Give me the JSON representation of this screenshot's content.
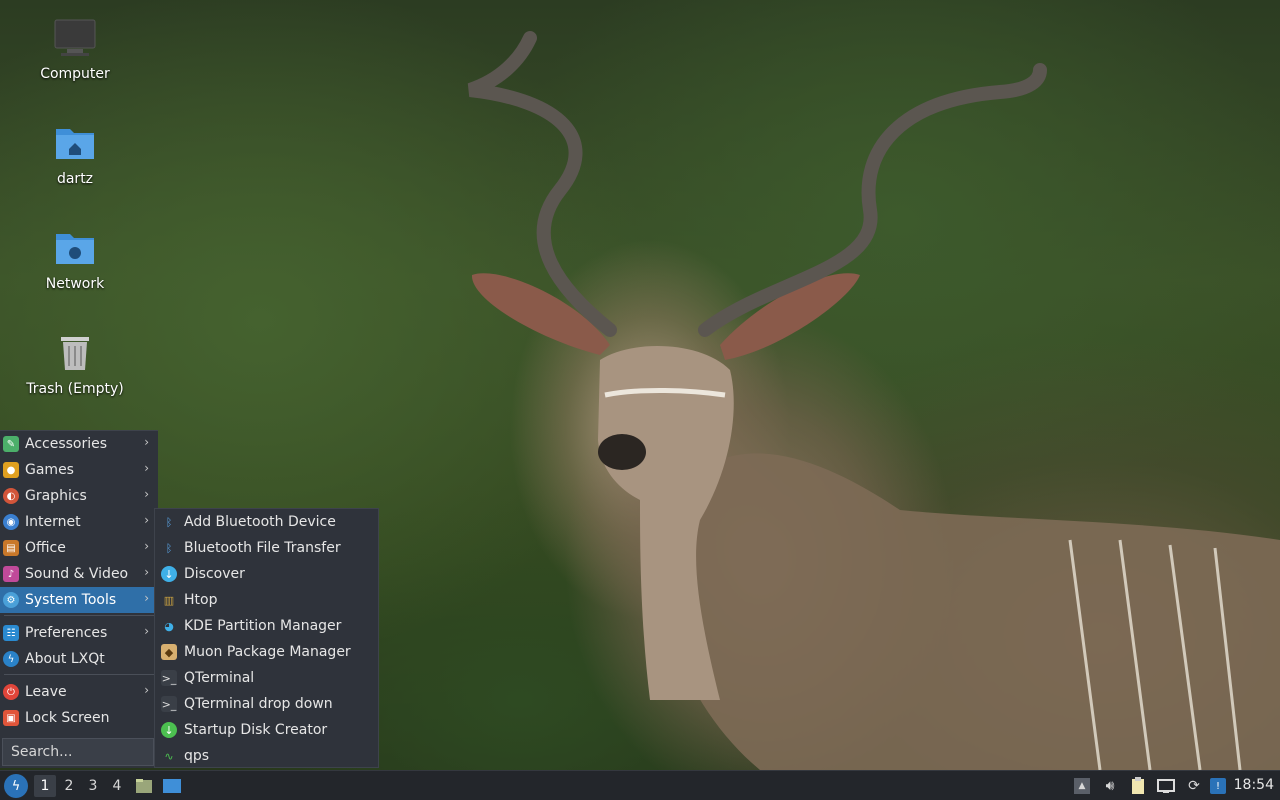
{
  "desktop": {
    "icons": [
      {
        "label": "Computer",
        "icon": "computer-icon"
      },
      {
        "label": "dartz",
        "icon": "home-folder-icon"
      },
      {
        "label": "Network",
        "icon": "network-folder-icon"
      },
      {
        "label": "Trash (Empty)",
        "icon": "trash-icon"
      }
    ]
  },
  "menu": {
    "items": [
      {
        "label": "Accessories",
        "icon": "accessories-icon",
        "color": "#4caf6a"
      },
      {
        "label": "Games",
        "icon": "games-icon",
        "color": "#e0a020"
      },
      {
        "label": "Graphics",
        "icon": "graphics-icon",
        "color": "#d2553a"
      },
      {
        "label": "Internet",
        "icon": "internet-icon",
        "color": "#3a7fd0"
      },
      {
        "label": "Office",
        "icon": "office-icon",
        "color": "#c8782a"
      },
      {
        "label": "Sound & Video",
        "icon": "sound-video-icon",
        "color": "#c04a9a"
      },
      {
        "label": "System Tools",
        "icon": "system-tools-icon",
        "color": "#4aa0d8"
      },
      {
        "label": "Preferences",
        "icon": "preferences-icon",
        "color": "#2a8ad0"
      },
      {
        "label": "About LXQt",
        "icon": "lxqt-icon",
        "color": "#2a82c8"
      },
      {
        "label": "Leave",
        "icon": "power-icon",
        "color": "#e0453a"
      },
      {
        "label": "Lock Screen",
        "icon": "lock-icon",
        "color": "#e0553a"
      }
    ],
    "search_placeholder": "Search..."
  },
  "submenu": {
    "items": [
      {
        "label": "Add Bluetooth Device",
        "icon": "bluetooth-icon"
      },
      {
        "label": "Bluetooth File Transfer",
        "icon": "bluetooth-icon"
      },
      {
        "label": "Discover",
        "icon": "discover-icon"
      },
      {
        "label": "Htop",
        "icon": "htop-icon"
      },
      {
        "label": "KDE Partition Manager",
        "icon": "partition-manager-icon"
      },
      {
        "label": "Muon Package Manager",
        "icon": "muon-icon"
      },
      {
        "label": "QTerminal",
        "icon": "terminal-icon"
      },
      {
        "label": "QTerminal drop down",
        "icon": "terminal-icon"
      },
      {
        "label": "Startup Disk Creator",
        "icon": "startup-disk-icon"
      },
      {
        "label": "qps",
        "icon": "qps-icon"
      }
    ]
  },
  "taskbar": {
    "desktops": [
      "1",
      "2",
      "3",
      "4"
    ],
    "active_desktop": "1",
    "clock": "18:54"
  }
}
